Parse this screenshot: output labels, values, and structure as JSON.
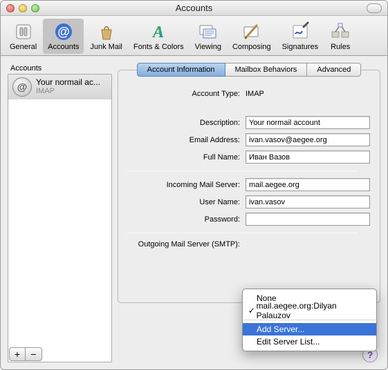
{
  "window": {
    "title": "Accounts"
  },
  "toolbar": {
    "general": "General",
    "accounts": "Accounts",
    "junk": "Junk Mail",
    "fonts": "Fonts & Colors",
    "viewing": "Viewing",
    "composing": "Composing",
    "signatures": "Signatures",
    "rules": "Rules"
  },
  "sidebar": {
    "header": "Accounts",
    "account": {
      "name": "Your normail ac...",
      "type": "IMAP"
    }
  },
  "tabs": {
    "info": "Account Information",
    "mailbox": "Mailbox Behaviors",
    "advanced": "Advanced"
  },
  "form": {
    "account_type_label": "Account Type:",
    "account_type_value": "IMAP",
    "description_label": "Description:",
    "description_value": "Your normail account",
    "email_label": "Email Address:",
    "email_value": "ivan.vasov@aegee.org",
    "fullname_label": "Full Name:",
    "fullname_value": "Иван Вазов",
    "incoming_label": "Incoming Mail Server:",
    "incoming_value": "mail.aegee.org",
    "username_label": "User Name:",
    "username_value": "ivan.vasov",
    "password_label": "Password:",
    "password_value": "",
    "smtp_label": "Outgoing Mail Server (SMTP):"
  },
  "smtp_menu": {
    "none": "None",
    "selected": "mail.aegee.org:Dilyan Palauzov",
    "add": "Add Server...",
    "edit": "Edit Server List..."
  },
  "buttons": {
    "plus": "+",
    "minus": "−",
    "help": "?"
  }
}
